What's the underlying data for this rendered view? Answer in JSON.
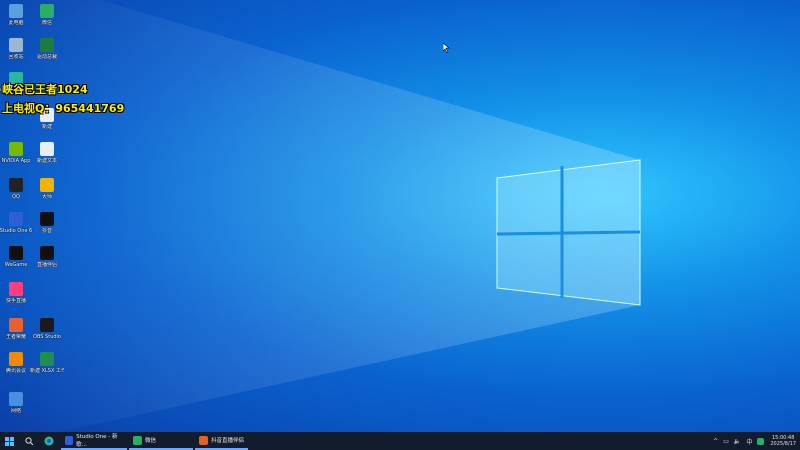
{
  "overlay": {
    "line1": "峡谷已王者1024",
    "line2": "上电视Q：965441769"
  },
  "desktop_icons": [
    {
      "id": "this-pc",
      "label": "此电脑",
      "icon": "computer-icon",
      "color": "#5aa0e0"
    },
    {
      "id": "wechat",
      "label": "微信",
      "icon": "wechat-icon",
      "color": "#2aae67"
    },
    {
      "id": "recycle-bin",
      "label": "回收站",
      "icon": "recycle-bin-icon",
      "color": "#9ab8d0"
    },
    {
      "id": "tool",
      "label": "驱动总裁",
      "icon": "app-icon",
      "color": "#1f7a3c"
    },
    {
      "id": "edge",
      "label": "Microsoft Edge",
      "icon": "edge-icon",
      "color": "#2bb6a0"
    },
    {
      "id": "doc",
      "label": "新建",
      "icon": "file-icon",
      "color": "#e8eef5"
    },
    {
      "id": "nvidia",
      "label": "NVIDIA App",
      "icon": "nvidia-icon",
      "color": "#76b900"
    },
    {
      "id": "doc2",
      "label": "新建文本",
      "icon": "file-icon",
      "color": "#e8eef5"
    },
    {
      "id": "qq",
      "label": "QQ",
      "icon": "qq-icon",
      "color": "#222222"
    },
    {
      "id": "search",
      "label": "大师",
      "icon": "search-icon",
      "color": "#f0b400"
    },
    {
      "id": "studio-one",
      "label": "Studio One 6",
      "icon": "studio-one-icon",
      "color": "#2d5fd6"
    },
    {
      "id": "tiktok",
      "label": "抖音",
      "icon": "tiktok-icon",
      "color": "#111111"
    },
    {
      "id": "wegame",
      "label": "WeGame",
      "icon": "wegame-icon",
      "color": "#111111"
    },
    {
      "id": "live",
      "label": "直播伴侣",
      "icon": "live-icon",
      "color": "#111111"
    },
    {
      "id": "kuaishou",
      "label": "快手直播",
      "icon": "kuaishou-icon",
      "color": "#ff3d7f"
    },
    {
      "id": "game",
      "label": "王者荣耀",
      "icon": "game-icon",
      "color": "#e6622a"
    },
    {
      "id": "obs",
      "label": "OBS Studio",
      "icon": "obs-icon",
      "color": "#1a1a1a"
    },
    {
      "id": "ae",
      "label": "腾讯会议",
      "icon": "meeting-icon",
      "color": "#f08a00"
    },
    {
      "id": "excel",
      "label": "新建 XLSX 工作表",
      "icon": "excel-icon",
      "color": "#1e8f4e"
    },
    {
      "id": "network",
      "label": "网络",
      "icon": "network-icon",
      "color": "#4a90e2"
    }
  ],
  "taskbar": {
    "start_icon": "windows-start-icon",
    "pinned": [
      {
        "label": "Studio One - 新歌...",
        "icon": "studio-one-icon",
        "color": "#2d5fd6"
      },
      {
        "label": "微信",
        "icon": "wechat-icon",
        "color": "#2aae67"
      },
      {
        "label": "抖音直播伴侣",
        "icon": "live-icon",
        "color": "#e0602a"
      }
    ],
    "tray": {
      "chevron": "^",
      "ime": "中",
      "time": "15:00:48",
      "date": "2025/8/17"
    }
  },
  "colors": {
    "wallpaper_center": "#2ec7ff",
    "wallpaper_edge": "#0a3fa8",
    "taskbar": "#121c2c",
    "overlay_text": "#ffee00"
  }
}
